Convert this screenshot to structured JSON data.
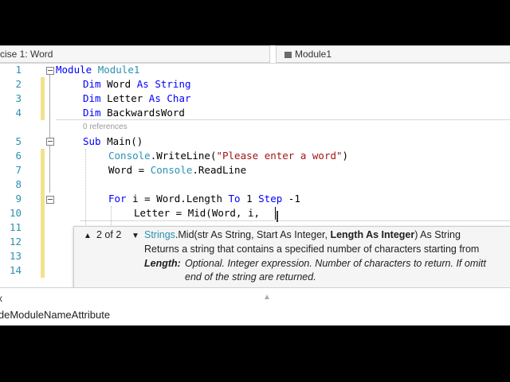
{
  "navbar": {
    "left": "rcise 1: Word",
    "right": "Module1"
  },
  "editor": {
    "line_numbers": [
      "1",
      "2",
      "3",
      "4",
      "5",
      "6",
      "7",
      "8",
      "9",
      "10",
      "11",
      "12",
      "13",
      "14"
    ],
    "references": "0 references",
    "lines": {
      "l1": {
        "kw": "Module",
        "name": "Module1"
      },
      "l2": {
        "kw1": "Dim",
        "name": "Word",
        "kw2": "As",
        "type": "String"
      },
      "l3": {
        "kw1": "Dim",
        "name": "Letter",
        "kw2": "As",
        "type": "Char"
      },
      "l4": {
        "kw1": "Dim",
        "name": "BackwardsWord"
      },
      "l5": {
        "kw": "Sub",
        "name": "Main()"
      },
      "l6": {
        "cls": "Console",
        "dot": ".",
        "method": "WriteLine",
        "open": "(",
        "str": "\"Please enter a word\"",
        "close": ")"
      },
      "l7": {
        "lhs": "Word = ",
        "cls": "Console",
        "dot": ".",
        "method": "ReadLine"
      },
      "l9": {
        "kw": "For",
        "mid": " i = Word.Length ",
        "kw2": "To",
        "mid2": " 1 ",
        "kw3": "Step",
        "tail": " -1"
      },
      "l10": {
        "text": "Letter = Mid(Word, i, ",
        "cursor": "|"
      }
    }
  },
  "tooltip": {
    "overload_count": "2 of 2",
    "signature": {
      "cls": "Strings",
      "method": ".Mid",
      "p1": "(str As String, Start As Integer, ",
      "p_bold": "Length As Integer",
      "p2": ") As String"
    },
    "description": "Returns a string that contains a specified number of characters starting from",
    "param_label": "Length:",
    "param_desc": "Optional. Integer expression. Number of characters to return. If omitt",
    "param_desc2": "end of the string are returned."
  },
  "bottom_panel": {
    "close_label": "x",
    "attribute_text": "ideModuleNameAttribute"
  },
  "colors": {
    "keyword": "#0000ff",
    "type": "#2b91af",
    "string": "#a31515",
    "line_number": "#2b91af",
    "change_marker": "#f2e28b"
  }
}
